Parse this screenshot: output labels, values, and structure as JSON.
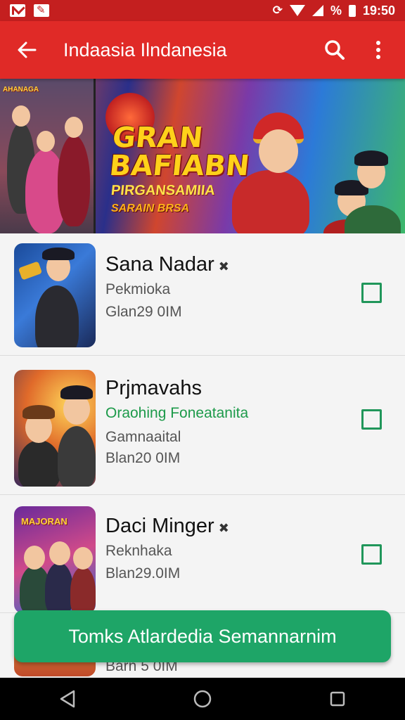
{
  "status_bar": {
    "battery_text": "%",
    "time": "19:50"
  },
  "app_bar": {
    "title": "Indaasia Ilndanesia"
  },
  "banner": {
    "left_logo": "AHANAGA",
    "title_line1": "GRAN",
    "title_line2": "BAFIABN",
    "subtitle": "PIRGANSAMIIA",
    "tag": "SARAIN BRSA"
  },
  "items": [
    {
      "title": "Sana Nadar",
      "line1": "Pekmioka",
      "line2": "Glan29 0IM",
      "line3": "",
      "checked": false
    },
    {
      "title": "Prjmavahs",
      "line1": "Oraohing Foneatanita",
      "line2": "Gamnaaital",
      "line3": "Blan20 0IM",
      "checked": false
    },
    {
      "title": "Daci Minger",
      "line1": "Reknhaka",
      "line2": "Blan29.0IM",
      "line3": "",
      "checked": false
    },
    {
      "title": "",
      "line1": "Barn 5 0IM",
      "line2": "",
      "line3": "",
      "checked": false
    }
  ],
  "cta": {
    "label": "Tomks Atlardedia Semannarnim"
  },
  "colors": {
    "status_bar": "#c41f1f",
    "app_bar": "#e02a27",
    "accent_green": "#1ea567",
    "checkbox_green": "#20965a"
  },
  "icons": {
    "back": "arrow-left-icon",
    "search": "search-icon",
    "more": "more-vert-icon",
    "nav_back": "triangle-back-icon",
    "nav_home": "circle-home-icon",
    "nav_recents": "square-recents-icon"
  }
}
